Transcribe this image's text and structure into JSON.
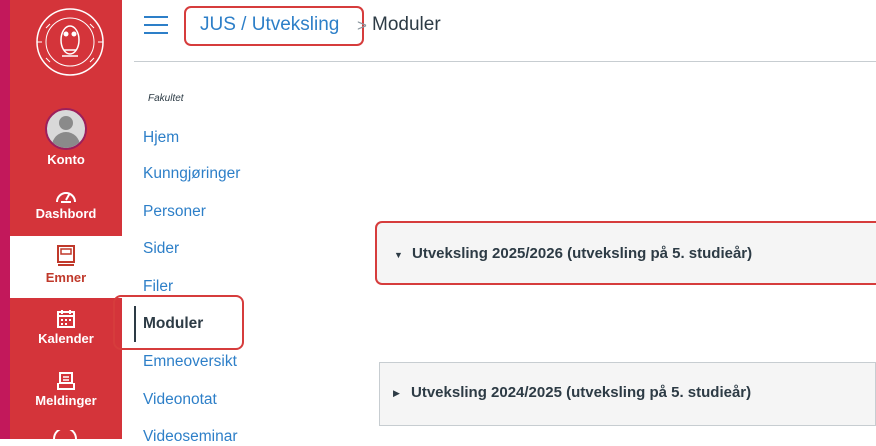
{
  "global_nav": {
    "logo_text": "UNIVERSITAS BERGENSIS",
    "items": [
      {
        "label": "Konto",
        "icon": "account-avatar-icon"
      },
      {
        "label": "Dashbord",
        "icon": "dashboard-icon"
      },
      {
        "label": "Emner",
        "icon": "courses-icon"
      },
      {
        "label": "Kalender",
        "icon": "calendar-icon"
      },
      {
        "label": "Meldinger",
        "icon": "inbox-icon"
      }
    ],
    "colors": {
      "background": "#d4343a",
      "accent": "#c2185b",
      "active_bg": "#ffffff"
    }
  },
  "header": {
    "breadcrumb_course": "JUS / Utveksling",
    "breadcrumb_separator": ">",
    "breadcrumb_current": "Moduler",
    "menu_icon": "hamburger-icon"
  },
  "course_nav": {
    "section_label": "Fakultet",
    "items": [
      {
        "label": "Hjem"
      },
      {
        "label": "Kunngjøringer"
      },
      {
        "label": "Personer"
      },
      {
        "label": "Sider"
      },
      {
        "label": "Filer"
      },
      {
        "label": "Moduler",
        "active": true
      },
      {
        "label": "Emneoversikt"
      },
      {
        "label": "Videonotat"
      },
      {
        "label": "Videoseminar"
      }
    ],
    "link_color": "#2d7fc8"
  },
  "modules": [
    {
      "title": "Utveksling 2025/2026 (utveksling på 5. studieår)",
      "state": "expanded",
      "toggle_icon": "triangle-down-icon"
    },
    {
      "title": "Utveksling 2024/2025 (utveksling på 5. studieår)",
      "state": "collapsed",
      "toggle_icon": "triangle-right-icon"
    }
  ],
  "highlight_color": "#d63c3c"
}
